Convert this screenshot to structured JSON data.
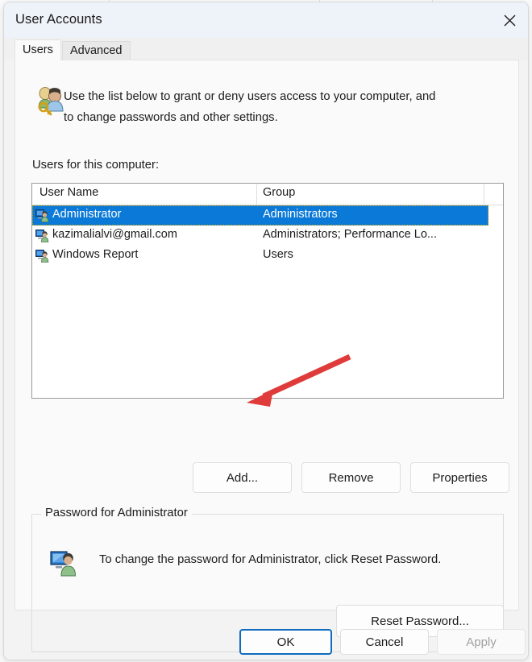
{
  "window": {
    "title": "User Accounts",
    "close_label": "✕",
    "close_icon": "close-icon"
  },
  "tabs": [
    {
      "label": "Users",
      "selected": true
    },
    {
      "label": "Advanced",
      "selected": false
    }
  ],
  "header": {
    "icon": "users-key-icon",
    "description": "Use the list below to grant or deny users access to your computer, and to change passwords and other settings."
  },
  "list": {
    "label": "Users for this computer:",
    "columns": [
      "User Name",
      "Group"
    ],
    "rows": [
      {
        "icon": "user-account-icon",
        "user_name": "Administrator",
        "group": "Administrators",
        "selected": true
      },
      {
        "icon": "user-account-icon",
        "user_name": "kazimalialvi@gmail.com",
        "group": "Administrators; Performance Lo...",
        "selected": false
      },
      {
        "icon": "user-account-icon",
        "user_name": "Windows Report",
        "group": "Users",
        "selected": false
      }
    ]
  },
  "list_actions": {
    "add": "Add...",
    "remove": "Remove",
    "properties": "Properties"
  },
  "password_group": {
    "title": "Password for Administrator",
    "icon": "user-account-icon",
    "description": "To change the password for Administrator, click Reset Password.",
    "reset_button": "Reset Password..."
  },
  "footer": {
    "ok": "OK",
    "cancel": "Cancel",
    "apply": "Apply",
    "apply_disabled": true,
    "ok_focused": true
  },
  "annotation": {
    "type": "arrow",
    "color": "#e03b3b",
    "points_to": "add-button"
  },
  "colors": {
    "selection_blue": "#0a79d8",
    "titlebar": "#eef2f9",
    "panel": "#fafafa",
    "accent_focus": "#0f6cbd",
    "arrow_red": "#e03b3b"
  }
}
